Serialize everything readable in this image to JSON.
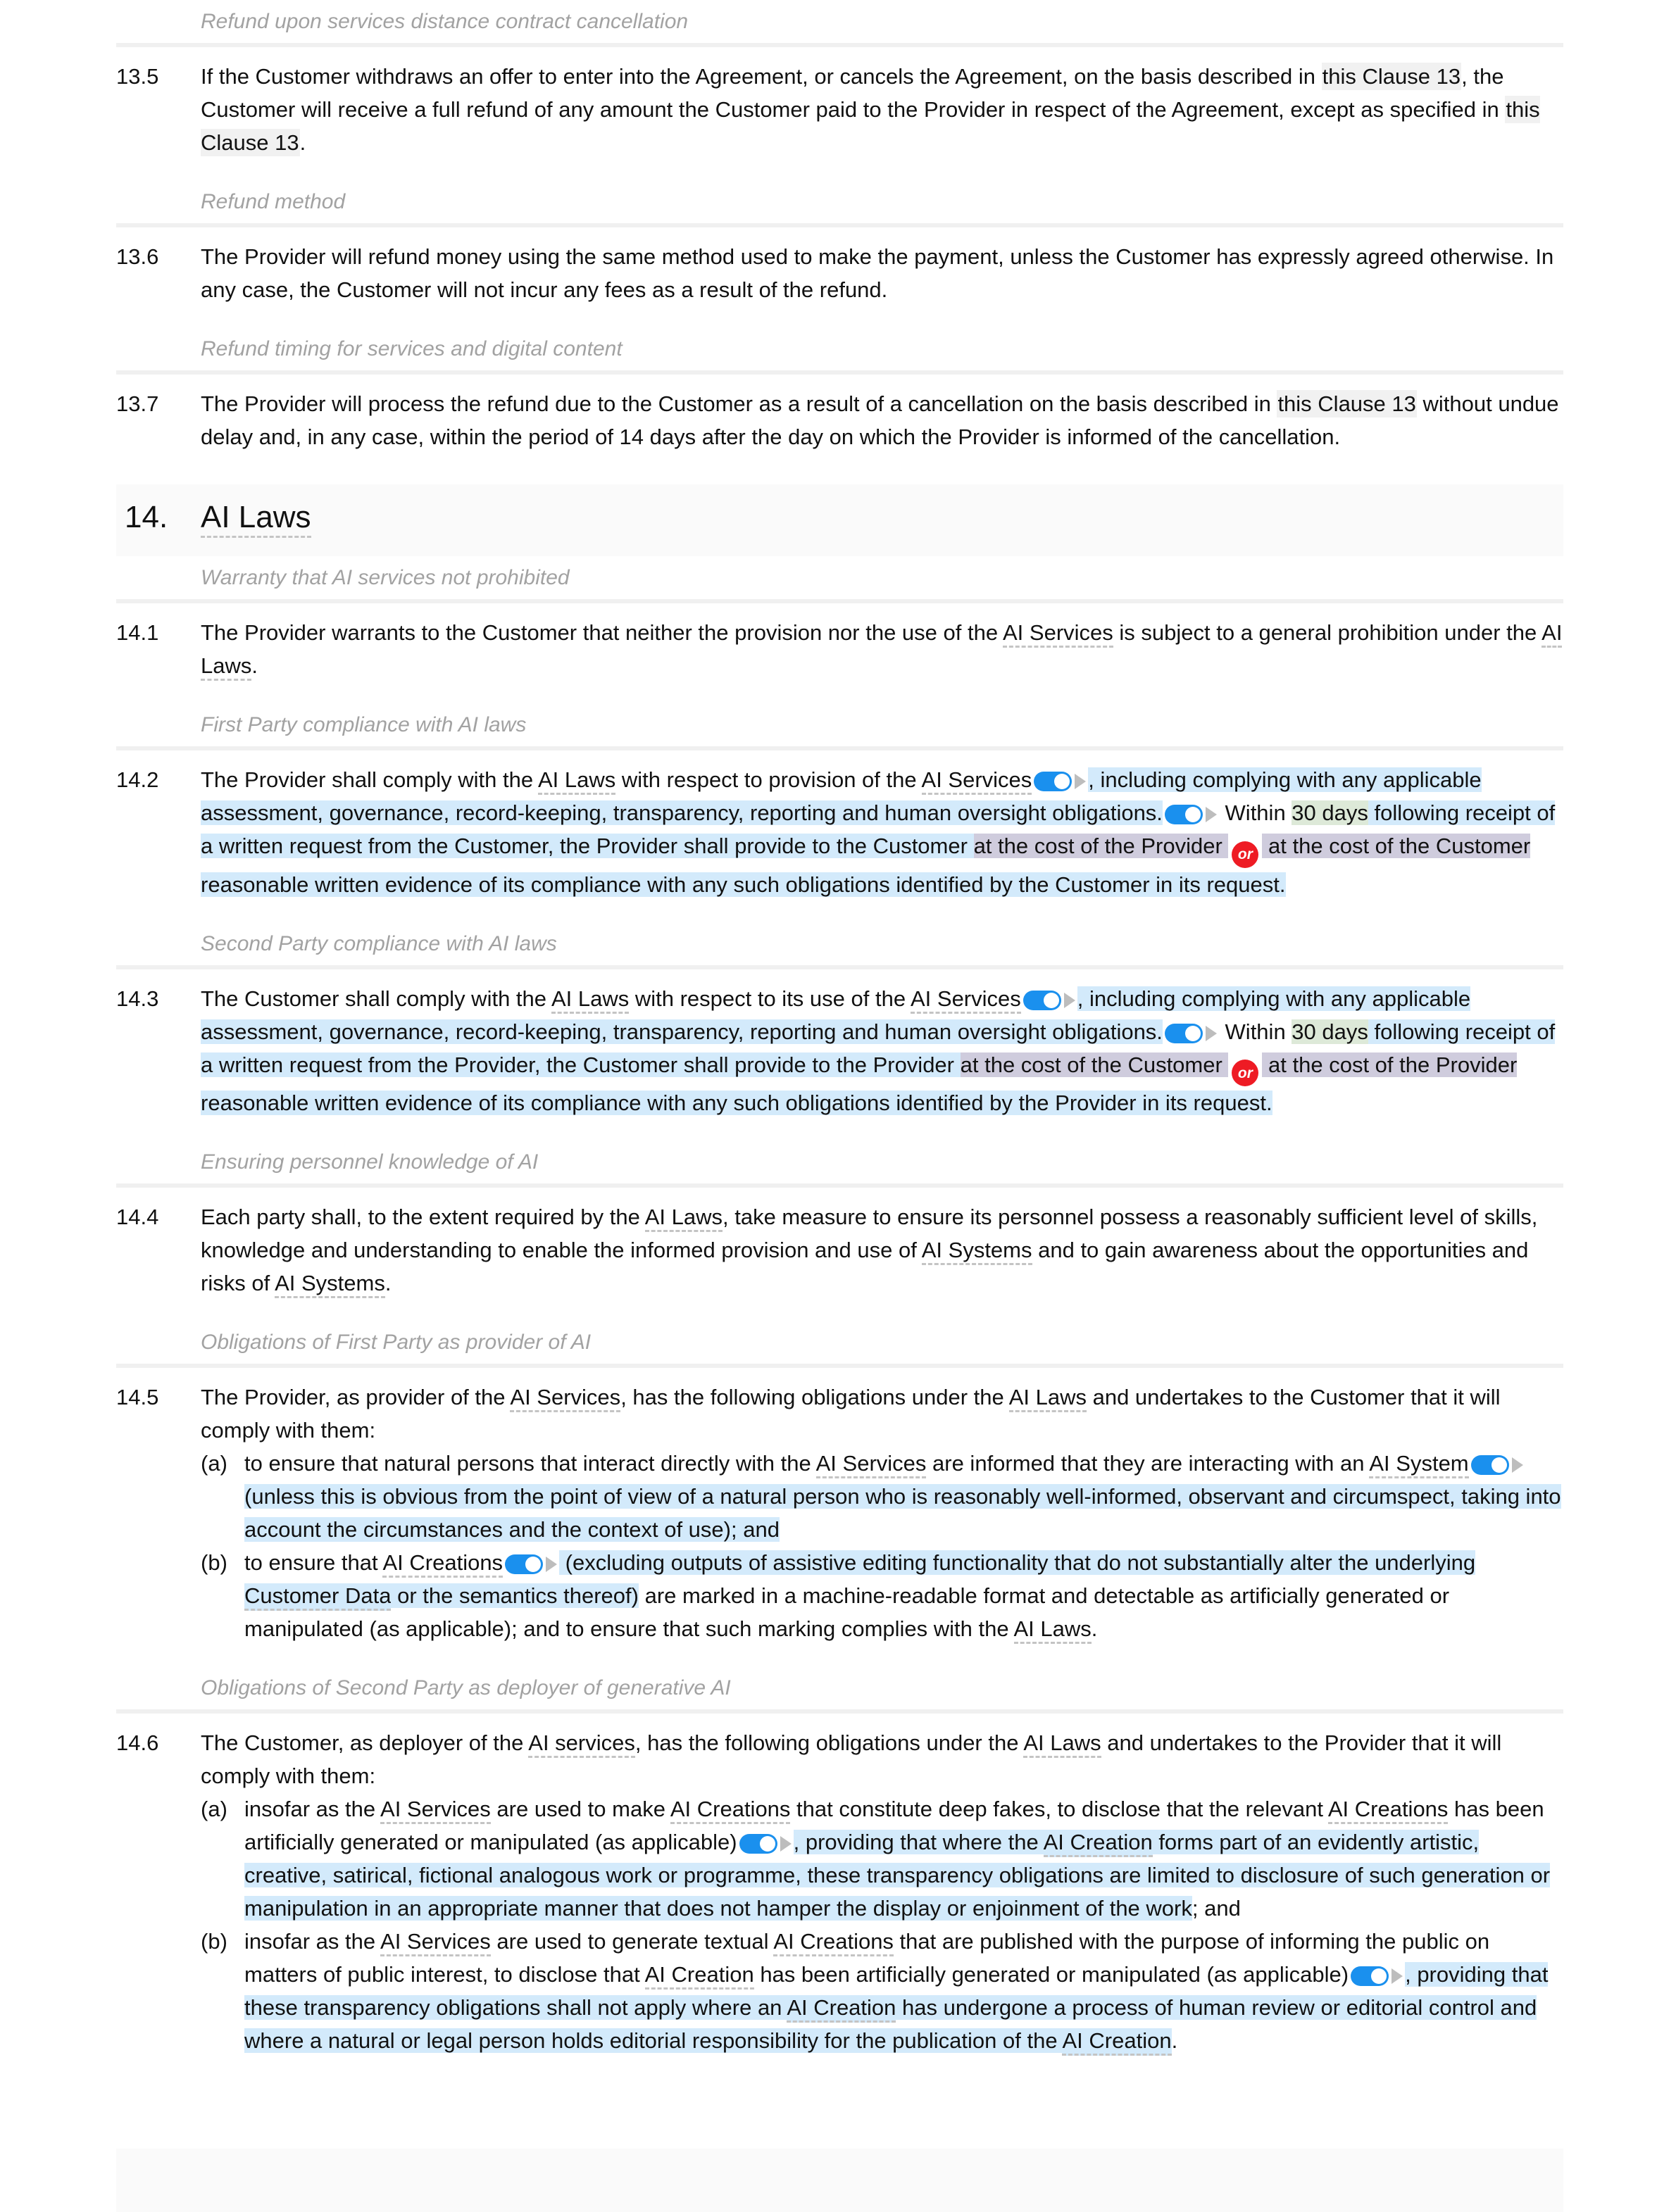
{
  "document": {
    "sections": [
      {
        "kind": "subhead",
        "name": "refund-distance-cancellation-subhead",
        "text": "Refund upon services distance contract cancellation"
      },
      {
        "kind": "clause",
        "name": "clause-13-5",
        "number": "13.5",
        "parts": [
          {
            "t": "If the Customer withdraws an offer to enter into the Agreement, or cancels the Agreement, on the basis described in "
          },
          {
            "t": "this Clause 13",
            "style": "xref"
          },
          {
            "t": ", the Customer will receive a full refund of any amount the Customer paid to the Provider in respect of the Agreement, except as specified in "
          },
          {
            "t": "this Clause 13",
            "style": "xref"
          },
          {
            "t": "."
          }
        ]
      },
      {
        "kind": "subhead",
        "name": "refund-method-subhead",
        "text": "Refund method"
      },
      {
        "kind": "clause",
        "name": "clause-13-6",
        "number": "13.6",
        "parts": [
          {
            "t": "The Provider will refund money using the same method used to make the payment, unless the Customer has expressly agreed otherwise. In any case, the Customer will not incur any fees as a result of the refund."
          }
        ]
      },
      {
        "kind": "subhead",
        "name": "refund-timing-subhead",
        "text": "Refund timing for services and digital content"
      },
      {
        "kind": "clause",
        "name": "clause-13-7",
        "number": "13.7",
        "parts": [
          {
            "t": "The Provider will process the refund due to the Customer as a result of a cancellation on the basis described in "
          },
          {
            "t": "this Clause 13",
            "style": "xref"
          },
          {
            "t": " without undue delay and, in any case, within the period of 14 days after the day on which the Provider is informed of the cancellation."
          }
        ]
      },
      {
        "kind": "section",
        "name": "section-14",
        "number": "14.",
        "title": "AI Laws",
        "title_term": true
      },
      {
        "kind": "subhead",
        "name": "warranty-ai-services-not-prohibited-subhead",
        "text": "Warranty that AI services not prohibited"
      },
      {
        "kind": "clause",
        "name": "clause-14-1",
        "number": "14.1",
        "parts": [
          {
            "t": "The Provider warrants to the Customer that neither the provision nor the use of the "
          },
          {
            "t": "AI Services",
            "style": "term"
          },
          {
            "t": " is subject to a general prohibition under the "
          },
          {
            "t": "AI Laws",
            "style": "term"
          },
          {
            "t": "."
          }
        ]
      },
      {
        "kind": "subhead",
        "name": "first-party-compliance-subhead",
        "text": "First Party compliance with AI laws"
      },
      {
        "kind": "clause",
        "name": "clause-14-2",
        "number": "14.2",
        "parts": [
          {
            "t": "The Provider shall comply with the "
          },
          {
            "t": "AI Laws",
            "style": "term"
          },
          {
            "t": " with respect to provision of the "
          },
          {
            "t": "AI Services",
            "style": "term"
          },
          {
            "t": " ",
            "style": "toggle"
          },
          {
            "t": ", including complying with any applicable assessment, governance, record-keeping, transparency, reporting and human oversight obligations.",
            "style": "hl-blue"
          },
          {
            "t": " ",
            "style": "toggle"
          },
          {
            "t": " Within ",
            "style": "plain"
          },
          {
            "t": "30 days",
            "style": "hl-green"
          },
          {
            "t": " following receipt of a written request from the Customer, the Provider shall provide to the Customer ",
            "style": "hl-blue"
          },
          {
            "t": "at the cost of the Provider ",
            "style": "hl-purple"
          },
          {
            "t": "or",
            "style": "orbadge"
          },
          {
            "t": " at the cost of the Customer",
            "style": "hl-purple"
          },
          {
            "t": " reasonable written evidence of its compliance with any such obligations identified by the Customer in its request.",
            "style": "hl-blue"
          }
        ]
      },
      {
        "kind": "subhead",
        "name": "second-party-compliance-subhead",
        "text": "Second Party compliance with AI laws"
      },
      {
        "kind": "clause",
        "name": "clause-14-3",
        "number": "14.3",
        "parts": [
          {
            "t": "The Customer shall comply with the "
          },
          {
            "t": "AI Laws",
            "style": "term"
          },
          {
            "t": " with respect to its use of the "
          },
          {
            "t": "AI Services",
            "style": "term"
          },
          {
            "t": " ",
            "style": "toggle"
          },
          {
            "t": ", including complying with any applicable assessment, governance, record-keeping, transparency, reporting and human oversight obligations.",
            "style": "hl-blue"
          },
          {
            "t": " ",
            "style": "toggle"
          },
          {
            "t": " Within ",
            "style": "plain"
          },
          {
            "t": "30 days",
            "style": "hl-green"
          },
          {
            "t": " following receipt of a written request from the Provider, the Customer shall provide to the Provider ",
            "style": "hl-blue"
          },
          {
            "t": "at the cost of the Customer ",
            "style": "hl-purple"
          },
          {
            "t": "or",
            "style": "orbadge"
          },
          {
            "t": " at the cost of the Provider",
            "style": "hl-purple"
          },
          {
            "t": " reasonable written evidence of its compliance with any such obligations identified by the Provider in its request.",
            "style": "hl-blue"
          }
        ]
      },
      {
        "kind": "subhead",
        "name": "ensuring-personnel-knowledge-subhead",
        "text": "Ensuring personnel knowledge of AI"
      },
      {
        "kind": "clause",
        "name": "clause-14-4",
        "number": "14.4",
        "parts": [
          {
            "t": "Each party shall, to the extent required by the "
          },
          {
            "t": "AI Laws",
            "style": "term"
          },
          {
            "t": ", take measure to ensure its personnel possess a reasonably sufficient level of skills, knowledge and understanding to enable the informed provision and use of "
          },
          {
            "t": "AI Systems",
            "style": "term"
          },
          {
            "t": " and to gain awareness about the opportunities and risks of "
          },
          {
            "t": "AI Systems",
            "style": "term"
          },
          {
            "t": "."
          }
        ]
      },
      {
        "kind": "subhead",
        "name": "obligations-first-party-provider-subhead",
        "text": "Obligations of First Party as provider of AI"
      },
      {
        "kind": "clause",
        "name": "clause-14-5",
        "number": "14.5",
        "parts": [
          {
            "t": "The Provider, as provider of the "
          },
          {
            "t": "AI Services",
            "style": "term"
          },
          {
            "t": ", has the following obligations under the "
          },
          {
            "t": "AI Laws",
            "style": "term"
          },
          {
            "t": " and undertakes to the Customer that it will comply with them:"
          }
        ],
        "subitems": [
          {
            "name": "clause-14-5-a",
            "label": "(a)",
            "parts": [
              {
                "t": "to ensure that natural persons that interact directly with the "
              },
              {
                "t": "AI Services",
                "style": "term"
              },
              {
                "t": " are informed that they are interacting with an "
              },
              {
                "t": "AI System",
                "style": "term"
              },
              {
                "t": " ",
                "style": "toggle"
              },
              {
                "t": " (unless this is obvious from the point of view of a natural person who is reasonably well-informed, observant and circumspect, taking into account the circumstances and the context of use); and",
                "style": "hl-blue"
              }
            ]
          },
          {
            "name": "clause-14-5-b",
            "label": "(b)",
            "parts": [
              {
                "t": "to ensure that "
              },
              {
                "t": "AI Creations",
                "style": "term"
              },
              {
                "t": " ",
                "style": "toggle"
              },
              {
                "t": " (excluding outputs of assistive editing functionality that do not substantially alter the underlying ",
                "style": "hl-blue"
              },
              {
                "t": "Customer Data",
                "style": "hl-blue-term"
              },
              {
                "t": " or the semantics thereof)",
                "style": "hl-blue"
              },
              {
                "t": " are marked in a machine-readable format and detectable as artificially generated or manipulated (as applicable); and to ensure that such marking complies with the "
              },
              {
                "t": "AI Laws",
                "style": "term"
              },
              {
                "t": "."
              }
            ]
          }
        ]
      },
      {
        "kind": "subhead",
        "name": "obligations-second-party-deployer-subhead",
        "text": "Obligations of Second Party as deployer of generative AI"
      },
      {
        "kind": "clause",
        "name": "clause-14-6",
        "number": "14.6",
        "parts": [
          {
            "t": "The Customer, as deployer of the "
          },
          {
            "t": "AI services",
            "style": "term"
          },
          {
            "t": ", has the following obligations under the "
          },
          {
            "t": "AI Laws",
            "style": "term"
          },
          {
            "t": " and undertakes to the Provider that it will comply with them:"
          }
        ],
        "subitems": [
          {
            "name": "clause-14-6-a",
            "label": "(a)",
            "parts": [
              {
                "t": "insofar as the "
              },
              {
                "t": "AI Services",
                "style": "term"
              },
              {
                "t": " are used to make "
              },
              {
                "t": "AI Creations",
                "style": "term"
              },
              {
                "t": " that constitute deep fakes, to disclose that the relevant "
              },
              {
                "t": "AI Creations",
                "style": "term"
              },
              {
                "t": " has been artificially generated or manipulated (as applicable)"
              },
              {
                "t": " ",
                "style": "toggle"
              },
              {
                "t": ", providing that where the ",
                "style": "hl-blue"
              },
              {
                "t": "AI Creation",
                "style": "hl-blue-term"
              },
              {
                "t": " forms part of an evidently artistic, creative, satirical, fictional analogous work or programme, these transparency obligations are limited to disclosure of such generation or manipulation in an appropriate manner that does not hamper the display or enjoinment of the work",
                "style": "hl-blue"
              },
              {
                "t": "; and"
              }
            ]
          },
          {
            "name": "clause-14-6-b",
            "label": "(b)",
            "parts": [
              {
                "t": "insofar as the "
              },
              {
                "t": "AI Services",
                "style": "term"
              },
              {
                "t": " are used to generate textual "
              },
              {
                "t": "AI Creations",
                "style": "term"
              },
              {
                "t": " that are published with the purpose of informing the public on matters of public interest, to disclose that "
              },
              {
                "t": "AI Creation",
                "style": "term"
              },
              {
                "t": " has been artificially generated or manipulated (as applicable)"
              },
              {
                "t": " ",
                "style": "toggle"
              },
              {
                "t": ", providing that these transparency obligations shall not apply where an ",
                "style": "hl-blue"
              },
              {
                "t": "AI Creation",
                "style": "hl-blue-term"
              },
              {
                "t": " has undergone a process of human review or editorial control and where a natural or legal person holds editorial responsibility for the publication of the ",
                "style": "hl-blue"
              },
              {
                "t": "AI Creation",
                "style": "hl-blue-term"
              },
              {
                "t": "."
              }
            ]
          }
        ]
      }
    ]
  },
  "colors": {
    "highlight_blue": "#d3eafb",
    "highlight_green": "#dde9d8",
    "highlight_purple": "#cfccdd",
    "xref_gray": "#f1f1f1",
    "toggle_on": "#1a90ee",
    "or_badge_red": "#ee1b24",
    "subhead_gray": "#a2a2a2",
    "section_band": "#fafafa"
  },
  "widgets": {
    "toggle_state": "on",
    "or_badge_label": "or"
  }
}
